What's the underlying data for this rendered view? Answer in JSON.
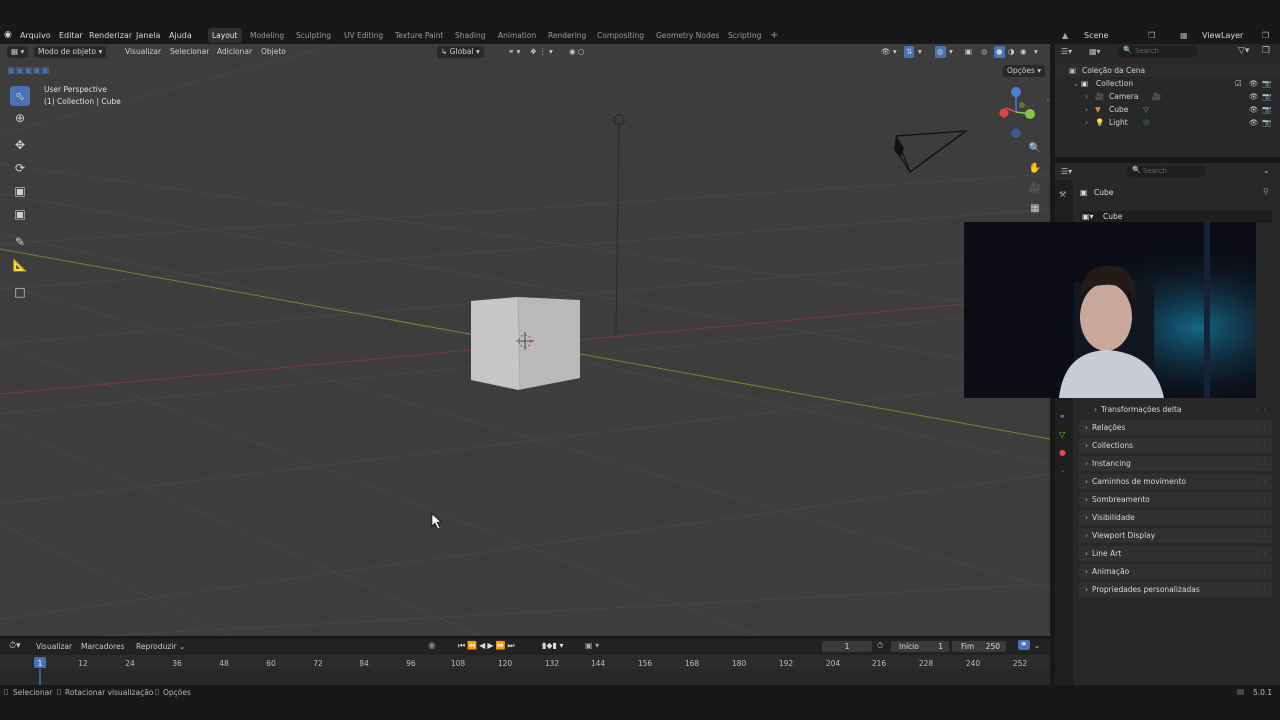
{
  "menubar": {
    "items": [
      "Arquivo",
      "Editar",
      "Renderizar",
      "Janela",
      "Ajuda"
    ],
    "workspaces": [
      "Layout",
      "Modeling",
      "Sculpting",
      "UV Editing",
      "Texture Paint",
      "Shading",
      "Animation",
      "Rendering",
      "Compositing",
      "Geometry Nodes",
      "Scripting"
    ],
    "active_workspace": "Layout",
    "add_tab": "+",
    "scene": "Scene",
    "view_layer": "ViewLayer"
  },
  "viewport_header": {
    "mode": "Modo de objeto",
    "menus": [
      "Visualizar",
      "Selecionar",
      "Adicionar",
      "Objeto"
    ],
    "orientation": "Global",
    "options": "Opções"
  },
  "viewport": {
    "perspective": "User Perspective",
    "context": "(1) Collection | Cube"
  },
  "outliner": {
    "search_placeholder": "Search",
    "root": "Coleção da Cena",
    "collection": "Collection",
    "objects": [
      "Camera",
      "Cube",
      "Light"
    ]
  },
  "properties": {
    "search_placeholder": "Search",
    "object_name": "Cube",
    "object_field": "Cube",
    "panels": [
      "Transformações delta",
      "Relações",
      "Collections",
      "Instancing",
      "Caminhos de movimento",
      "Sombreamento",
      "Visibilidade",
      "Viewport Display",
      "Line Art",
      "Animação",
      "Propriedades personalizadas"
    ]
  },
  "timeline": {
    "menus": [
      "Visualizar",
      "Marcadores",
      "Reproduzir"
    ],
    "current_frame": "1",
    "start_label": "Início",
    "start_value": "1",
    "end_label": "Fim",
    "end_value": "250",
    "frames": [
      "1",
      "12",
      "24",
      "36",
      "48",
      "60",
      "72",
      "84",
      "96",
      "108",
      "120",
      "132",
      "144",
      "156",
      "168",
      "180",
      "192",
      "204",
      "216",
      "228",
      "240",
      "252"
    ]
  },
  "statusbar": {
    "select": "Selecionar",
    "rotate": "Rotacionar visualização",
    "options": "Opções",
    "version": "5.0.1"
  },
  "colors": {
    "accent": "#4772b3",
    "viewport_bg": "#3d3d3d",
    "panel_bg": "#282828",
    "x_axis": "#9b3a3a",
    "y_axis": "#7c9e30"
  }
}
